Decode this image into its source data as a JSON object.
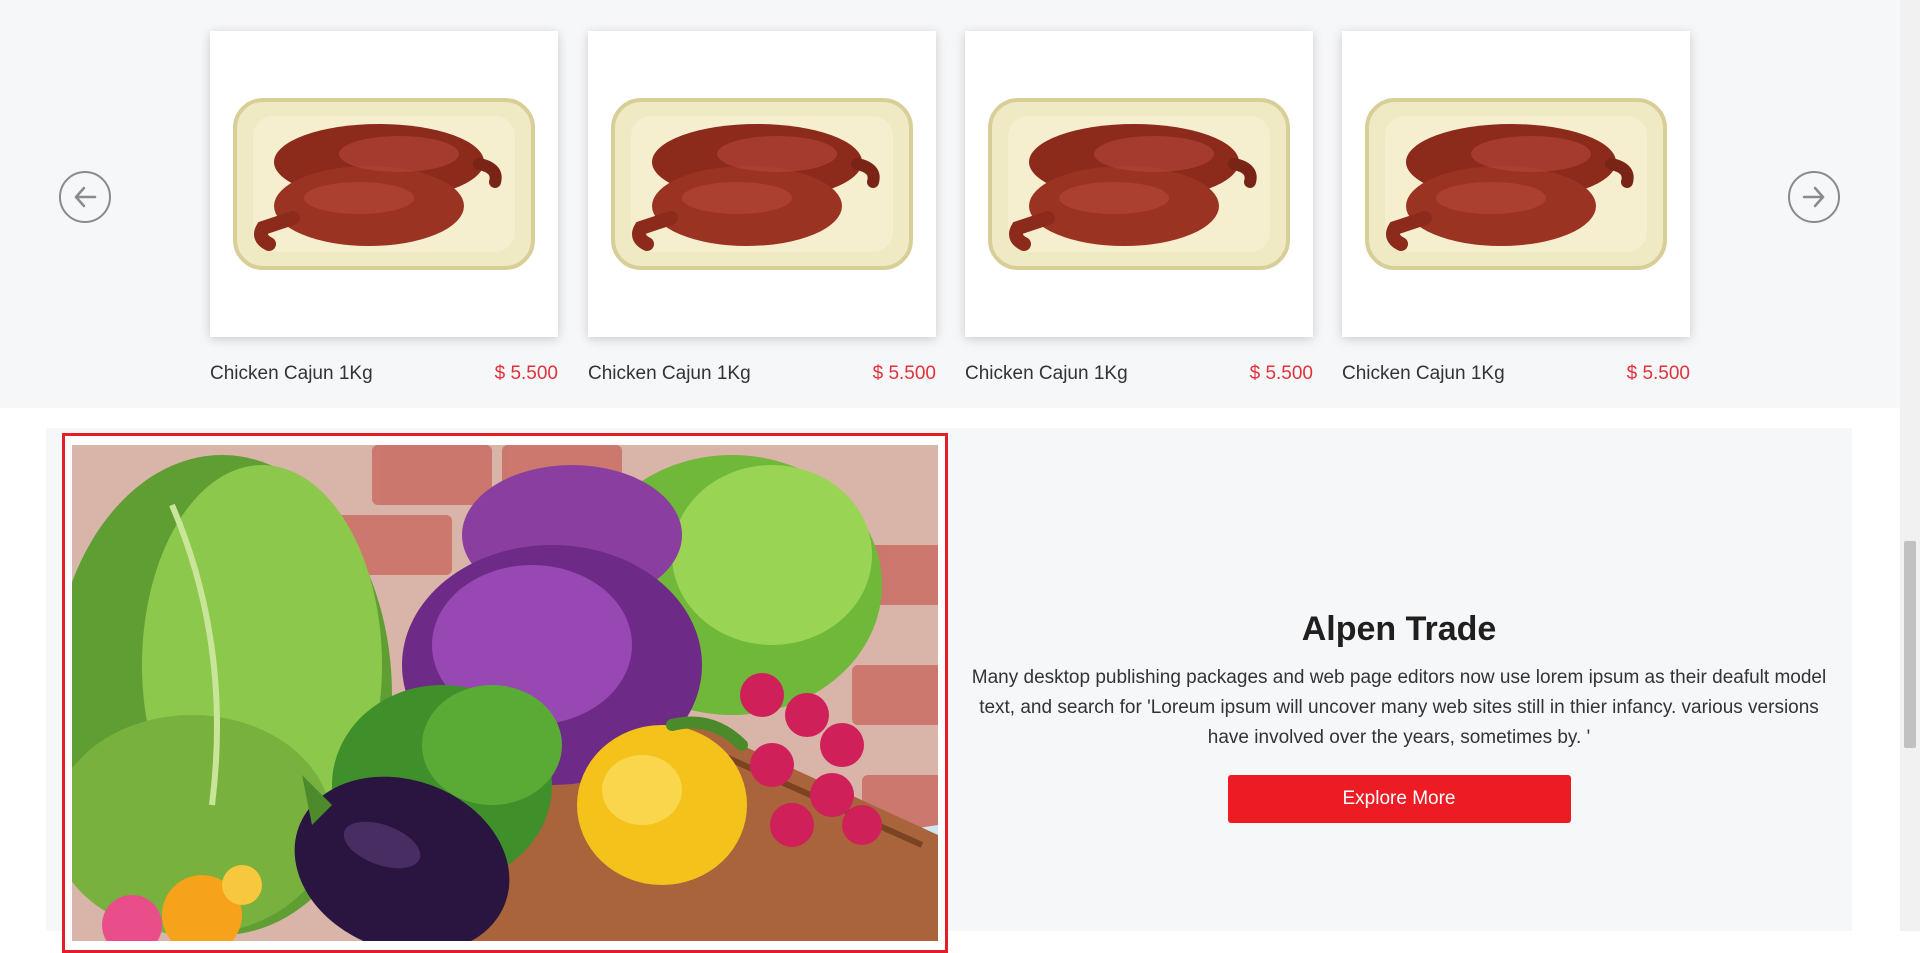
{
  "carousel": {
    "prev_icon": "arrow-left-circle-icon",
    "next_icon": "arrow-right-circle-icon",
    "products": [
      {
        "name": "Chicken Cajun 1Kg",
        "price": "$ 5.500",
        "image": "chicken-cajun-tray"
      },
      {
        "name": "Chicken Cajun 1Kg",
        "price": "$ 5.500",
        "image": "chicken-cajun-tray"
      },
      {
        "name": "Chicken Cajun 1Kg",
        "price": "$ 5.500",
        "image": "chicken-cajun-tray"
      },
      {
        "name": "Chicken Cajun 1Kg",
        "price": "$ 5.500",
        "image": "chicken-cajun-tray"
      }
    ]
  },
  "promo": {
    "image": "vegetable-basket",
    "title": "Alpen Trade",
    "description": "Many desktop publishing packages and web page editors now use lorem ipsum as their deafult model text, and search for 'Loreum ipsum will uncover many web sites still in thier infancy. various versions have involved over the years, sometimes by. '",
    "button_label": "Explore More"
  },
  "colors": {
    "accent": "#ed1c24",
    "price": "#e0323a",
    "section_bg": "#f6f7f9"
  }
}
